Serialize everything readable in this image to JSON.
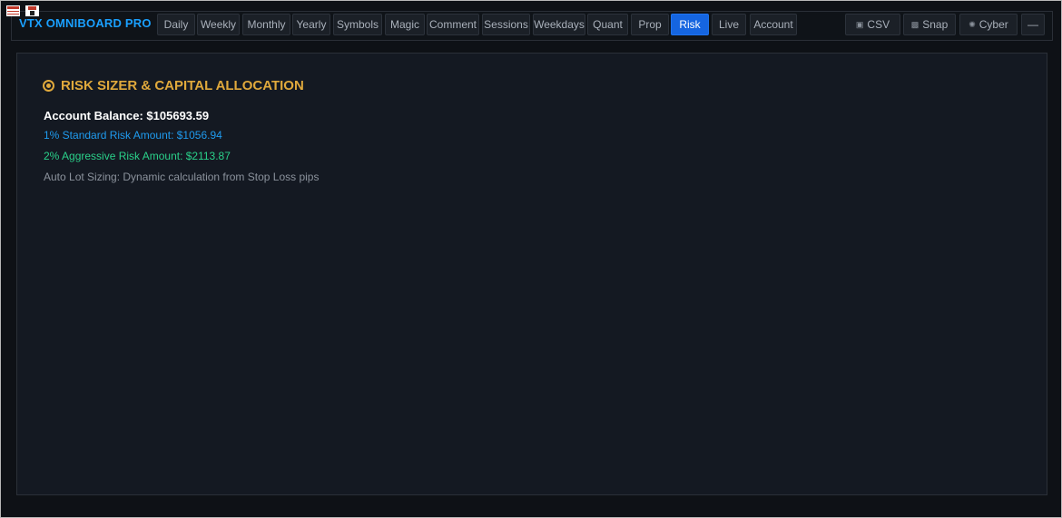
{
  "window": {
    "corner_icons": [
      "table-icon",
      "save-icon"
    ]
  },
  "header": {
    "brand": "VTX OMNIBOARD PRO",
    "tabs": [
      {
        "label": "Daily",
        "active": false
      },
      {
        "label": "Weekly",
        "active": false
      },
      {
        "label": "Monthly",
        "active": false
      },
      {
        "label": "Yearly",
        "active": false
      },
      {
        "label": "Symbols",
        "active": false
      },
      {
        "label": "Magic",
        "active": false
      },
      {
        "label": "Comment",
        "active": false
      },
      {
        "label": "Sessions",
        "active": false
      },
      {
        "label": "Weekdays",
        "active": false
      },
      {
        "label": "Quant",
        "active": false
      },
      {
        "label": "Prop",
        "active": false
      },
      {
        "label": "Risk",
        "active": true
      },
      {
        "label": "Live",
        "active": false
      },
      {
        "label": "Account",
        "active": false
      }
    ],
    "tools": [
      {
        "label": "CSV",
        "icon": "export-icon"
      },
      {
        "label": "Snap",
        "icon": "camera-icon"
      },
      {
        "label": "Cyber",
        "icon": "theme-icon"
      },
      {
        "label": "—",
        "icon": ""
      }
    ]
  },
  "risk": {
    "title": "RISK SIZER & CAPITAL ALLOCATION",
    "title_icon": "target-icon",
    "balance_line": "Account Balance: $105693.59",
    "standard_line": "1% Standard Risk Amount: $1056.94",
    "aggressive_line": "2% Aggressive Risk Amount: $2113.87",
    "auto_line": "Auto Lot Sizing: Dynamic calculation from Stop Loss pips"
  },
  "colors": {
    "brand": "#1aa0ff",
    "accent_active_tab": "#1565e0",
    "title": "#e0a93c",
    "standard": "#1f9bef",
    "aggressive": "#2ad18a",
    "muted": "#8b929c"
  }
}
